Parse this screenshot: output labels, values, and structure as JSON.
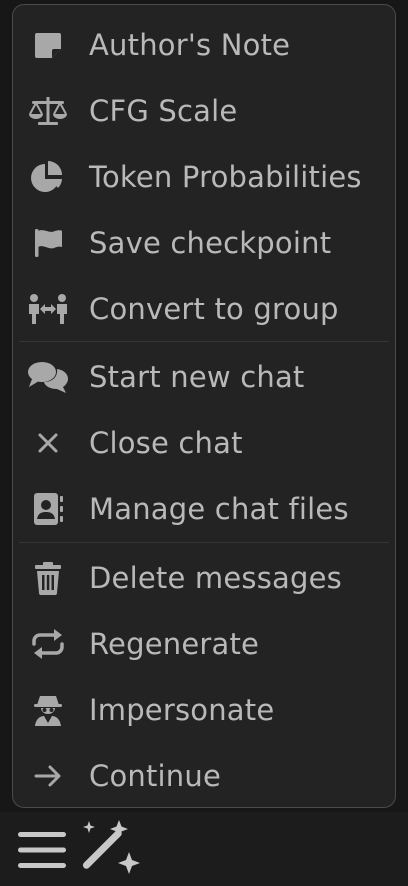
{
  "menu": {
    "items": [
      {
        "label": "Author's Note",
        "icon": "note-sticky-icon"
      },
      {
        "label": "CFG Scale",
        "icon": "scale-balanced-icon"
      },
      {
        "label": "Token Probabilities",
        "icon": "chart-pie-icon"
      },
      {
        "label": "Save checkpoint",
        "icon": "flag-icon"
      },
      {
        "label": "Convert to group",
        "icon": "people-arrows-icon"
      },
      {
        "label": "Start new chat",
        "icon": "comments-icon"
      },
      {
        "label": "Close chat",
        "icon": "xmark-icon"
      },
      {
        "label": "Manage chat files",
        "icon": "address-book-icon"
      },
      {
        "label": "Delete messages",
        "icon": "trash-can-icon"
      },
      {
        "label": "Regenerate",
        "icon": "repeat-icon"
      },
      {
        "label": "Impersonate",
        "icon": "user-secret-icon"
      },
      {
        "label": "Continue",
        "icon": "arrow-right-icon"
      }
    ]
  },
  "bottom_bar": {
    "options_icon": "bars-icon",
    "extensions_icon": "magic-wand-icon"
  },
  "colors": {
    "menu_background": "#232323",
    "menu_text": "#b9b9b9",
    "icon": "#a8a8a8",
    "border": "#4a4a4a"
  }
}
